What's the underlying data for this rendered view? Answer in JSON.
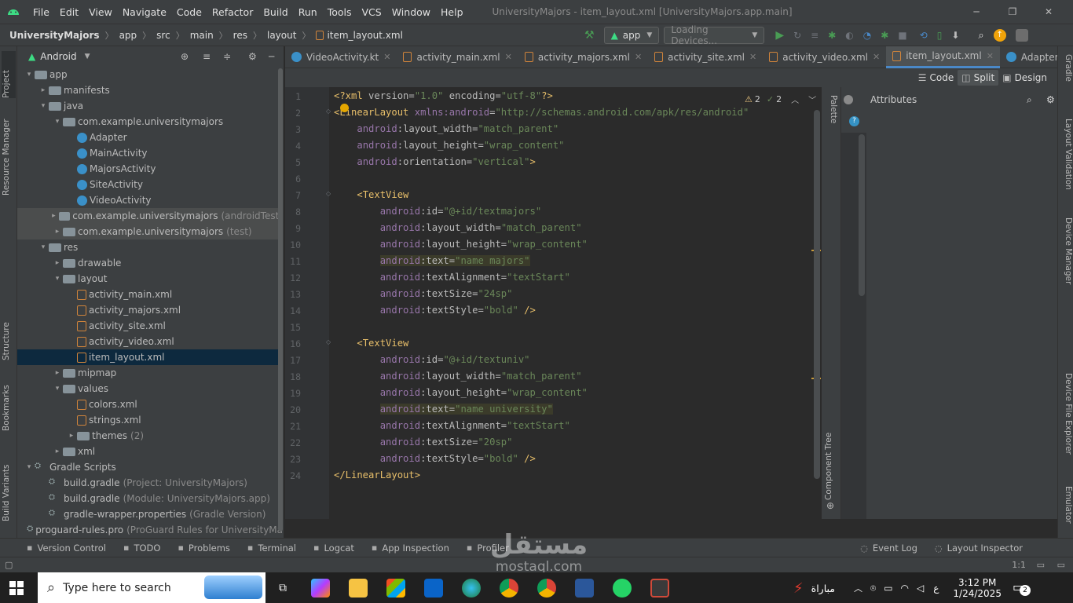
{
  "menu": [
    "File",
    "Edit",
    "View",
    "Navigate",
    "Code",
    "Refactor",
    "Build",
    "Run",
    "Tools",
    "VCS",
    "Window",
    "Help"
  ],
  "window_title": "UniversityMajors - item_layout.xml [UniversityMajors.app.main]",
  "breadcrumb": [
    "UniversityMajors",
    "app",
    "src",
    "main",
    "res",
    "layout",
    "item_layout.xml"
  ],
  "run_config": "app",
  "device_selector": "Loading Devices...",
  "project_view": "Android",
  "tree": [
    {
      "label": "app",
      "indent": 0,
      "arrow": "▾",
      "icon": "folder"
    },
    {
      "label": "manifests",
      "indent": 1,
      "arrow": "▸",
      "icon": "folder"
    },
    {
      "label": "java",
      "indent": 1,
      "arrow": "▾",
      "icon": "folder"
    },
    {
      "label": "com.example.universitymajors",
      "indent": 2,
      "arrow": "▾",
      "icon": "folder"
    },
    {
      "label": "Adapter",
      "indent": 3,
      "arrow": "",
      "icon": "class"
    },
    {
      "label": "MainActivity",
      "indent": 3,
      "arrow": "",
      "icon": "class"
    },
    {
      "label": "MajorsActivity",
      "indent": 3,
      "arrow": "",
      "icon": "class"
    },
    {
      "label": "SiteActivity",
      "indent": 3,
      "arrow": "",
      "icon": "class"
    },
    {
      "label": "VideoActivity",
      "indent": 3,
      "arrow": "",
      "icon": "class"
    },
    {
      "label": "com.example.universitymajors",
      "suffix": "(androidTest)",
      "indent": 2,
      "arrow": "▸",
      "icon": "folder",
      "style": "grey"
    },
    {
      "label": "com.example.universitymajors",
      "suffix": "(test)",
      "indent": 2,
      "arrow": "▸",
      "icon": "folder",
      "style": "grey"
    },
    {
      "label": "res",
      "indent": 1,
      "arrow": "▾",
      "icon": "folder"
    },
    {
      "label": "drawable",
      "indent": 2,
      "arrow": "▸",
      "icon": "folder"
    },
    {
      "label": "layout",
      "indent": 2,
      "arrow": "▾",
      "icon": "folder"
    },
    {
      "label": "activity_main.xml",
      "indent": 3,
      "arrow": "",
      "icon": "xml"
    },
    {
      "label": "activity_majors.xml",
      "indent": 3,
      "arrow": "",
      "icon": "xml"
    },
    {
      "label": "activity_site.xml",
      "indent": 3,
      "arrow": "",
      "icon": "xml"
    },
    {
      "label": "activity_video.xml",
      "indent": 3,
      "arrow": "",
      "icon": "xml"
    },
    {
      "label": "item_layout.xml",
      "indent": 3,
      "arrow": "",
      "icon": "xml",
      "style": "sel"
    },
    {
      "label": "mipmap",
      "indent": 2,
      "arrow": "▸",
      "icon": "folder"
    },
    {
      "label": "values",
      "indent": 2,
      "arrow": "▾",
      "icon": "folder"
    },
    {
      "label": "colors.xml",
      "indent": 3,
      "arrow": "",
      "icon": "xml"
    },
    {
      "label": "strings.xml",
      "indent": 3,
      "arrow": "",
      "icon": "xml"
    },
    {
      "label": "themes",
      "suffix": "(2)",
      "indent": 3,
      "arrow": "▸",
      "icon": "folder"
    },
    {
      "label": "xml",
      "indent": 2,
      "arrow": "▸",
      "icon": "folder"
    },
    {
      "label": "Gradle Scripts",
      "indent": 0,
      "arrow": "▾",
      "icon": "gradle"
    },
    {
      "label": "build.gradle",
      "suffix": "(Project: UniversityMajors)",
      "indent": 1,
      "arrow": "",
      "icon": "gradle"
    },
    {
      "label": "build.gradle",
      "suffix": "(Module: UniversityMajors.app)",
      "indent": 1,
      "arrow": "",
      "icon": "gradle"
    },
    {
      "label": "gradle-wrapper.properties",
      "suffix": "(Gradle Version)",
      "indent": 1,
      "arrow": "",
      "icon": "gradle"
    },
    {
      "label": "proguard-rules.pro",
      "suffix": "(ProGuard Rules for UniversityMa",
      "indent": 1,
      "arrow": "",
      "icon": "gradle"
    }
  ],
  "tabs": [
    {
      "label": "VideoActivity.kt",
      "icon": "class"
    },
    {
      "label": "activity_main.xml",
      "icon": "xml"
    },
    {
      "label": "activity_majors.xml",
      "icon": "xml"
    },
    {
      "label": "activity_site.xml",
      "icon": "xml"
    },
    {
      "label": "activity_video.xml",
      "icon": "xml"
    },
    {
      "label": "item_layout.xml",
      "icon": "xml",
      "active": true
    },
    {
      "label": "Adapter.kt",
      "icon": "class"
    }
  ],
  "view_modes": {
    "code": "Code",
    "split": "Split",
    "design": "Design"
  },
  "inspections": {
    "warnings": "2",
    "weak": "2"
  },
  "code_lines": [
    [
      [
        "tag",
        "<?xml "
      ],
      [
        "attr",
        "version="
      ],
      [
        "val",
        "\"1.0\""
      ],
      [
        "attr",
        " encoding="
      ],
      [
        "val",
        "\"utf-8\""
      ],
      [
        "tag",
        "?>"
      ]
    ],
    [
      [
        "tag",
        "<LinearLayout "
      ],
      [
        "ns",
        "xmlns:android"
      ],
      [
        "attr",
        "="
      ],
      [
        "val",
        "\"http://schemas.android.com/apk/res/android\""
      ]
    ],
    [
      [
        "plain",
        "    "
      ],
      [
        "ns",
        "android"
      ],
      [
        "attr",
        ":layout_width="
      ],
      [
        "val",
        "\"match_parent\""
      ]
    ],
    [
      [
        "plain",
        "    "
      ],
      [
        "ns",
        "android"
      ],
      [
        "attr",
        ":layout_height="
      ],
      [
        "val",
        "\"wrap_content\""
      ]
    ],
    [
      [
        "plain",
        "    "
      ],
      [
        "ns",
        "android"
      ],
      [
        "attr",
        ":orientation="
      ],
      [
        "val",
        "\"vertical\""
      ],
      [
        "tag",
        ">"
      ]
    ],
    [],
    [
      [
        "plain",
        "    "
      ],
      [
        "tag",
        "<TextView"
      ]
    ],
    [
      [
        "plain",
        "        "
      ],
      [
        "ns",
        "android"
      ],
      [
        "attr",
        ":id="
      ],
      [
        "val",
        "\"@+id/textmajors\""
      ]
    ],
    [
      [
        "plain",
        "        "
      ],
      [
        "ns",
        "android"
      ],
      [
        "attr",
        ":layout_width="
      ],
      [
        "val",
        "\"match_parent\""
      ]
    ],
    [
      [
        "plain",
        "        "
      ],
      [
        "ns",
        "android"
      ],
      [
        "attr",
        ":layout_height="
      ],
      [
        "val",
        "\"wrap_content\""
      ]
    ],
    [
      [
        "plain",
        "        "
      ],
      [
        "ns",
        "android",
        "hl"
      ],
      [
        "attr",
        ":text=",
        "hl"
      ],
      [
        "val",
        "\"name majors\"",
        "hl"
      ]
    ],
    [
      [
        "plain",
        "        "
      ],
      [
        "ns",
        "android"
      ],
      [
        "attr",
        ":textAlignment="
      ],
      [
        "val",
        "\"textStart\""
      ]
    ],
    [
      [
        "plain",
        "        "
      ],
      [
        "ns",
        "android"
      ],
      [
        "attr",
        ":textSize="
      ],
      [
        "val",
        "\"24sp\""
      ]
    ],
    [
      [
        "plain",
        "        "
      ],
      [
        "ns",
        "android"
      ],
      [
        "attr",
        ":textStyle="
      ],
      [
        "val",
        "\"bold\""
      ],
      [
        "tag",
        " />"
      ]
    ],
    [],
    [
      [
        "plain",
        "    "
      ],
      [
        "tag",
        "<TextView"
      ]
    ],
    [
      [
        "plain",
        "        "
      ],
      [
        "ns",
        "android"
      ],
      [
        "attr",
        ":id="
      ],
      [
        "val",
        "\"@+id/textuniv\""
      ]
    ],
    [
      [
        "plain",
        "        "
      ],
      [
        "ns",
        "android"
      ],
      [
        "attr",
        ":layout_width="
      ],
      [
        "val",
        "\"match_parent\""
      ]
    ],
    [
      [
        "plain",
        "        "
      ],
      [
        "ns",
        "android"
      ],
      [
        "attr",
        ":layout_height="
      ],
      [
        "val",
        "\"wrap_content\""
      ]
    ],
    [
      [
        "plain",
        "        "
      ],
      [
        "ns",
        "android",
        "hl"
      ],
      [
        "attr",
        ":text=",
        "hl"
      ],
      [
        "val",
        "\"name university\"",
        "hl"
      ]
    ],
    [
      [
        "plain",
        "        "
      ],
      [
        "ns",
        "android"
      ],
      [
        "attr",
        ":textAlignment="
      ],
      [
        "val",
        "\"textStart\""
      ]
    ],
    [
      [
        "plain",
        "        "
      ],
      [
        "ns",
        "android"
      ],
      [
        "attr",
        ":textSize="
      ],
      [
        "val",
        "\"20sp\""
      ]
    ],
    [
      [
        "plain",
        "        "
      ],
      [
        "ns",
        "android"
      ],
      [
        "attr",
        ":textStyle="
      ],
      [
        "val",
        "\"bold\""
      ],
      [
        "tag",
        " />"
      ]
    ],
    [
      [
        "tag",
        "</LinearLayout>"
      ]
    ]
  ],
  "right_panel": {
    "palette": "Palette",
    "attributes": "Attributes",
    "component_tree": "Component Tree"
  },
  "left_stripe": [
    "Project",
    "Resource Manager",
    "Structure",
    "Bookmarks",
    "Build Variants"
  ],
  "right_stripe": [
    "Gradle",
    "Layout Validation",
    "Device Manager",
    "Device File Explorer",
    "Emulator"
  ],
  "bottom_tools": [
    {
      "label": "Version Control",
      "icon": "branch-icon"
    },
    {
      "label": "TODO",
      "icon": "list-icon"
    },
    {
      "label": "Problems",
      "icon": "warning-icon"
    },
    {
      "label": "Terminal",
      "icon": "terminal-icon"
    },
    {
      "label": "Logcat",
      "icon": "logcat-icon"
    },
    {
      "label": "App Inspection",
      "icon": "inspect-icon"
    },
    {
      "label": "Profiler",
      "icon": "profiler-icon"
    }
  ],
  "bottom_right_tools": [
    {
      "label": "Event Log",
      "icon": "event-log-icon"
    },
    {
      "label": "Layout Inspector",
      "icon": "layout-inspector-icon"
    }
  ],
  "status": {
    "position": "1:1"
  },
  "taskbar": {
    "search_placeholder": "Type here to search",
    "weather_text": "مباراة",
    "lang": "ع",
    "time": "3:12 PM",
    "date": "1/24/2025",
    "notifications": "2"
  },
  "watermark": {
    "arabic": "مستقل",
    "latin": "mostaql.com"
  },
  "colors": {
    "accent": "#4a88c7",
    "run": "#499c54",
    "warning": "#e5c07b"
  }
}
